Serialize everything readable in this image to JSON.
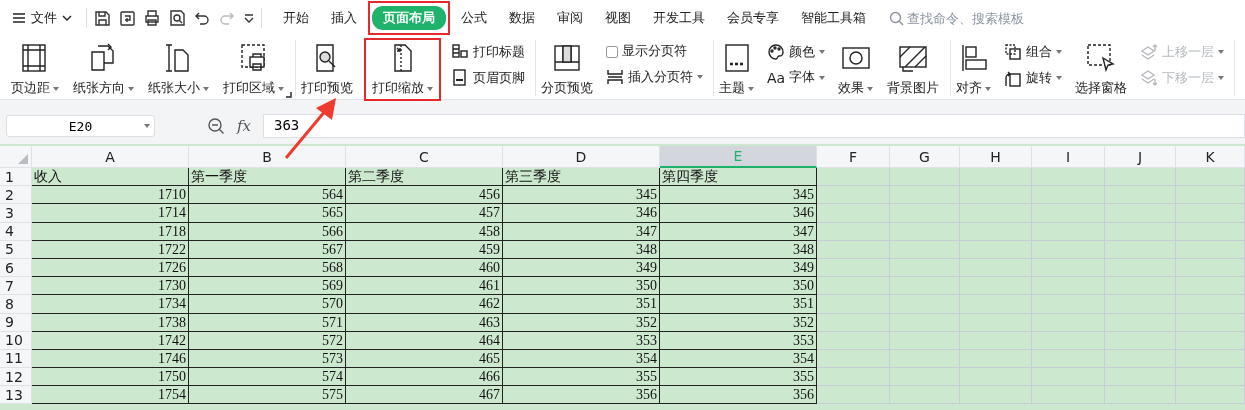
{
  "menu": {
    "label": "文件"
  },
  "tabs": [
    {
      "label": "开始",
      "selected": false,
      "highlighted": false
    },
    {
      "label": "插入",
      "selected": false,
      "highlighted": false
    },
    {
      "label": "页面布局",
      "selected": true,
      "highlighted": true
    },
    {
      "label": "公式",
      "selected": false,
      "highlighted": false
    },
    {
      "label": "数据",
      "selected": false,
      "highlighted": false
    },
    {
      "label": "审阅",
      "selected": false,
      "highlighted": false
    },
    {
      "label": "视图",
      "selected": false,
      "highlighted": false
    },
    {
      "label": "开发工具",
      "selected": false,
      "highlighted": false
    },
    {
      "label": "会员专享",
      "selected": false,
      "highlighted": false
    },
    {
      "label": "智能工具箱",
      "selected": false,
      "highlighted": false
    }
  ],
  "search": {
    "placeholder": "查找命令、搜索模板"
  },
  "ribbon": {
    "groups": [
      {
        "launcher": true,
        "items": [
          {
            "kind": "large",
            "label": "页边距",
            "dropdown": true,
            "highlighted": false
          },
          {
            "kind": "large",
            "label": "纸张方向",
            "dropdown": true,
            "highlighted": false
          },
          {
            "kind": "large",
            "label": "纸张大小",
            "dropdown": true,
            "highlighted": false
          },
          {
            "kind": "large",
            "label": "打印区域",
            "dropdown": true,
            "highlighted": false
          }
        ]
      },
      {
        "launcher": false,
        "items": [
          {
            "kind": "large",
            "label": "打印预览",
            "dropdown": false,
            "highlighted": false
          },
          {
            "kind": "large",
            "label": "打印缩放",
            "dropdown": true,
            "highlighted": true
          },
          {
            "kind": "stack",
            "items": [
              {
                "kind": "small",
                "label": "打印标题",
                "dropdown": false,
                "disabled": false
              },
              {
                "kind": "small",
                "label": "页眉页脚",
                "dropdown": false,
                "disabled": false
              }
            ]
          }
        ]
      },
      {
        "launcher": false,
        "items": [
          {
            "kind": "large",
            "label": "分页预览",
            "dropdown": false,
            "highlighted": false
          },
          {
            "kind": "stack",
            "items": [
              {
                "kind": "checkbox",
                "label": "显示分页符",
                "checked": false,
                "disabled": false
              },
              {
                "kind": "small",
                "label": "插入分页符",
                "dropdown": true,
                "disabled": false
              }
            ]
          }
        ]
      },
      {
        "launcher": false,
        "items": [
          {
            "kind": "large",
            "label": "主题",
            "dropdown": true,
            "highlighted": false
          },
          {
            "kind": "stack",
            "items": [
              {
                "kind": "small",
                "label": "颜色",
                "dropdown": true,
                "disabled": false
              },
              {
                "kind": "small",
                "label": "字体",
                "glyph": "Aa",
                "dropdown": true,
                "disabled": false
              }
            ]
          },
          {
            "kind": "large",
            "label": "效果",
            "dropdown": true,
            "highlighted": false
          },
          {
            "kind": "large",
            "label": "背景图片",
            "dropdown": false,
            "highlighted": false
          }
        ]
      },
      {
        "launcher": false,
        "items": [
          {
            "kind": "large",
            "label": "对齐",
            "dropdown": true,
            "highlighted": false
          },
          {
            "kind": "stack",
            "items": [
              {
                "kind": "small",
                "label": "组合",
                "dropdown": true,
                "disabled": false
              },
              {
                "kind": "small",
                "label": "旋转",
                "dropdown": true,
                "disabled": false
              }
            ]
          },
          {
            "kind": "large",
            "label": "选择窗格",
            "dropdown": false,
            "highlighted": false
          },
          {
            "kind": "stack",
            "items": [
              {
                "kind": "small",
                "label": "上移一层",
                "dropdown": true,
                "disabled": true
              },
              {
                "kind": "small",
                "label": "下移一层",
                "dropdown": true,
                "disabled": true
              }
            ]
          }
        ]
      }
    ]
  },
  "formula_bar": {
    "name_box": "E20",
    "fx": "fx",
    "value": "363"
  },
  "sheet": {
    "columns": [
      {
        "label": "A",
        "selected": false
      },
      {
        "label": "B",
        "selected": false
      },
      {
        "label": "C",
        "selected": false
      },
      {
        "label": "D",
        "selected": false
      },
      {
        "label": "E",
        "selected": true
      },
      {
        "label": "F",
        "selected": false
      },
      {
        "label": "G",
        "selected": false
      },
      {
        "label": "H",
        "selected": false
      },
      {
        "label": "I",
        "selected": false
      },
      {
        "label": "J",
        "selected": false
      },
      {
        "label": "K",
        "selected": false
      }
    ],
    "rows": [
      {
        "number": "1",
        "kind": "text",
        "cells": [
          "收入",
          "第一季度",
          "第二季度",
          "第三季度",
          "第四季度"
        ]
      },
      {
        "number": "2",
        "kind": "number",
        "cells": [
          "1710",
          "564",
          "456",
          "345",
          "345"
        ]
      },
      {
        "number": "3",
        "kind": "number",
        "cells": [
          "1714",
          "565",
          "457",
          "346",
          "346"
        ]
      },
      {
        "number": "4",
        "kind": "number",
        "cells": [
          "1718",
          "566",
          "458",
          "347",
          "347"
        ]
      },
      {
        "number": "5",
        "kind": "number",
        "cells": [
          "1722",
          "567",
          "459",
          "348",
          "348"
        ]
      },
      {
        "number": "6",
        "kind": "number",
        "cells": [
          "1726",
          "568",
          "460",
          "349",
          "349"
        ]
      },
      {
        "number": "7",
        "kind": "number",
        "cells": [
          "1730",
          "569",
          "461",
          "350",
          "350"
        ]
      },
      {
        "number": "8",
        "kind": "number",
        "cells": [
          "1734",
          "570",
          "462",
          "351",
          "351"
        ]
      },
      {
        "number": "9",
        "kind": "number",
        "cells": [
          "1738",
          "571",
          "463",
          "352",
          "352"
        ]
      },
      {
        "number": "10",
        "kind": "number",
        "cells": [
          "1742",
          "572",
          "464",
          "353",
          "353"
        ]
      },
      {
        "number": "11",
        "kind": "number",
        "cells": [
          "1746",
          "573",
          "465",
          "354",
          "354"
        ]
      },
      {
        "number": "12",
        "kind": "number",
        "cells": [
          "1750",
          "574",
          "466",
          "355",
          "355"
        ]
      },
      {
        "number": "13",
        "kind": "number",
        "cells": [
          "1754",
          "575",
          "467",
          "356",
          "356"
        ]
      }
    ]
  }
}
